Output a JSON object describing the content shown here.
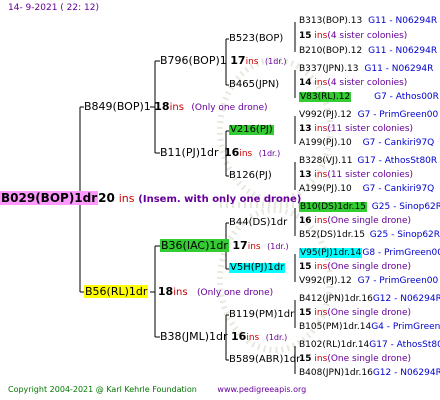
{
  "header": {
    "date": "14-  9-2021 ( 22: 12)"
  },
  "footer": {
    "copyright": "Copyright 2004-2021 @ Karl Kehrle Foundation",
    "url": "www.pedigreeapis.org"
  },
  "colors": {
    "magenta": "#ff99ff",
    "yellow": "#ffff00",
    "green": "#33cc33",
    "cyan": "#00ffff",
    "red": "#cc0000",
    "blue": "#0000cc"
  },
  "root": {
    "id": "B029(BOP)1dr",
    "ins": "20",
    "ins_word": "ins",
    "note": "(Insem. with only one drone)"
  },
  "gen1": [
    {
      "id": "B849(BOP)1",
      "ins": "18",
      "ins_word": "ins",
      "note": "(Only one drone)"
    },
    {
      "id": "B56(RL)1dr",
      "ins": "18",
      "ins_word": "ins",
      "note": "(Only one drone)"
    }
  ],
  "gen2": [
    {
      "id": "B796(BOP)1",
      "ins": "17",
      "ins_word": "ins",
      "note": "(1dr.)"
    },
    {
      "id": "B11(PJ)1dr",
      "ins": "16",
      "ins_word": "ins",
      "note": "(1dr.)"
    },
    {
      "id": "B36(IAC)1dr",
      "ins": "17",
      "ins_word": "ins",
      "note": "(1dr.)"
    },
    {
      "id": "B38(JML)1dr",
      "ins": "16",
      "ins_word": "ins",
      "note": "(1dr.)"
    }
  ],
  "gen3": [
    {
      "id": "B523(BOP)"
    },
    {
      "id": "B465(JPN)"
    },
    {
      "id": "V216(PJ)"
    },
    {
      "id": "B126(PJ)"
    },
    {
      "id": "B44(DS)1dr"
    },
    {
      "id": "V5H(PJ)1dr"
    },
    {
      "id": "B119(PM)1dr"
    },
    {
      "id": "B589(ABR)1dr"
    }
  ],
  "gen4": [
    {
      "id": "B313(BOP).13",
      "ref": "G11 - N06294R"
    },
    {
      "id": "B210(BOP).12",
      "ref": "G11 - N06294R"
    },
    {
      "id": "B337(JPN).13",
      "ref": "G11 - N06294R"
    },
    {
      "id": "V83(RL).12",
      "ref": "G7 - Athos00R"
    },
    {
      "id": "V992(PJ).12",
      "ref": "G7 - PrimGreen00"
    },
    {
      "id": "A199(PJ).10",
      "ref": "G7 - Cankiri97Q"
    },
    {
      "id": "B328(VJ).11",
      "ref": "G17 - AthosSt80R"
    },
    {
      "id": "A199(PJ).10",
      "ref": "G7 - Cankiri97Q"
    },
    {
      "id": "B10(DS)1dr.15",
      "ref": "G25 - Sinop62R"
    },
    {
      "id": "B52(DS)1dr.15",
      "ref": "G25 - Sinop62R"
    },
    {
      "id": "V95(PJ)1dr.14",
      "ref": "G8 - PrimGreen00"
    },
    {
      "id": "V992(PJ).12",
      "ref": "G7 - PrimGreen00"
    },
    {
      "id": "B412(JPN)1dr.16",
      "ref": "G12 - N06294R"
    },
    {
      "id": "B105(PM)1dr.14",
      "ref": "G4 - PrimGreen00"
    },
    {
      "id": "B102(RL)1dr.14",
      "ref": "G17 - AthosSt80R"
    },
    {
      "id": "B408(JPN)1dr.16",
      "ref": "G12 - N06294R"
    }
  ],
  "gen3_ins": [
    {
      "num": "15",
      "word": "ins",
      "note": "(4 sister colonies)"
    },
    {
      "num": "14",
      "word": "ins",
      "note": "(4 sister colonies)"
    },
    {
      "num": "13",
      "word": "ins",
      "note": "(11 sister colonies)"
    },
    {
      "num": "13",
      "word": "ins",
      "note": "(11 sister colonies)"
    },
    {
      "num": "16",
      "word": "ins",
      "note": "(One single drone)"
    },
    {
      "num": "15",
      "word": "ins",
      "note": "(One single drone)"
    },
    {
      "num": "15",
      "word": "ins",
      "note": "(One single drone)"
    },
    {
      "num": "15",
      "word": "ins",
      "note": "(One single drone)"
    }
  ]
}
